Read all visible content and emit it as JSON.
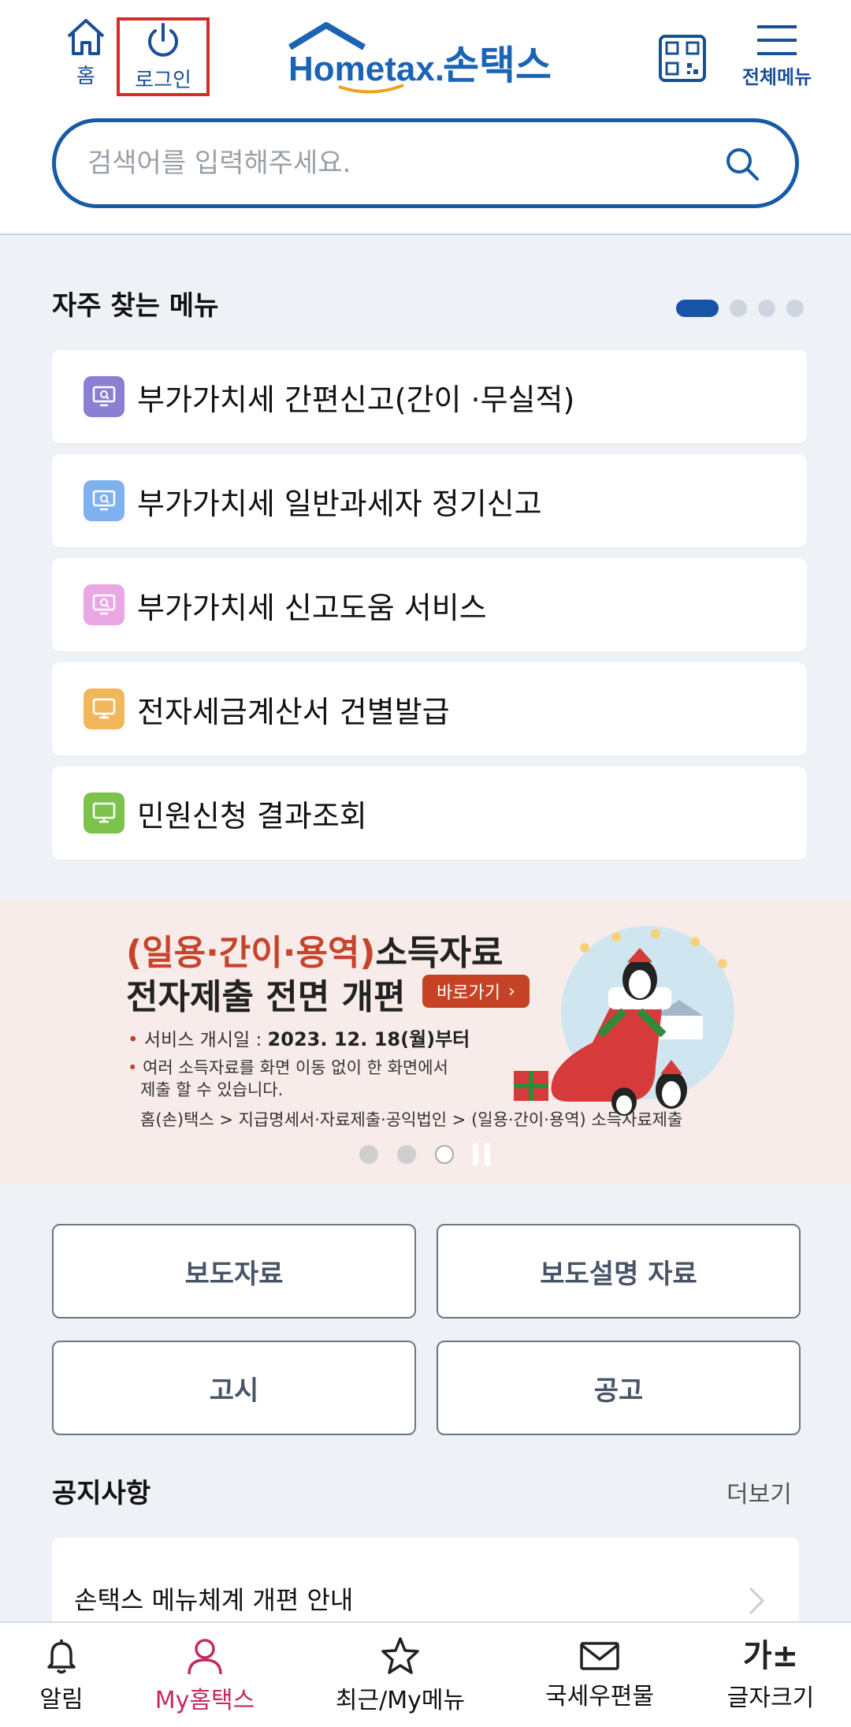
{
  "header": {
    "home_label": "홈",
    "login_label": "로그인",
    "logo_text_en": "Hometax.",
    "logo_text_ko": "손택스",
    "all_menu_label": "전체메뉴"
  },
  "search": {
    "placeholder": "검색어를 입력해주세요."
  },
  "frequent_menu": {
    "title": "자주 찾는 메뉴",
    "pages": 4,
    "active_page": 1,
    "items": [
      {
        "label": "부가가치세 간편신고(간이 ·무실적)",
        "icon_color": "#8b7fd3",
        "icon": "search-monitor-icon"
      },
      {
        "label": "부가가치세 일반과세자 정기신고",
        "icon_color": "#7fb0f0",
        "icon": "search-monitor-icon"
      },
      {
        "label": "부가가치세 신고도움 서비스",
        "icon_color": "#e9a7e3",
        "icon": "search-monitor-icon"
      },
      {
        "label": "전자세금계산서 건별발급",
        "icon_color": "#f2b65c",
        "icon": "monitor-icon"
      },
      {
        "label": "민원신청 결과조회",
        "icon_color": "#7cc24d",
        "icon": "monitor-icon"
      }
    ]
  },
  "banner": {
    "line1_highlight": "(일용·간이·용역)",
    "line1_rest": "소득자료",
    "line2": "전자제출 전면 개편",
    "go_label": "바로가기",
    "bullet1_prefix": "서비스 개시일 : ",
    "bullet1_date": "2023. 12. 18(월)부터",
    "bullet2_line1": "여러 소득자료를 화면 이동 없이 한 화면에서",
    "bullet2_line2": "제출 할 수 있습니다.",
    "path": "홈(손)택스 > 지급명세서·자료제출·공익법인 > (일용·간이·용역) 소득자료제출",
    "slides": 3,
    "current_slide": 3
  },
  "quick_buttons": {
    "press": "보도자료",
    "press_explain": "보도설명 자료",
    "notice_public": "고시",
    "announcement": "공고"
  },
  "notice": {
    "title": "공지사항",
    "more_label": "더보기",
    "items": [
      {
        "text": "손택스 메뉴체계 개편 안내"
      }
    ]
  },
  "bottom_nav": {
    "alarm": "알림",
    "my_hometax": "My홈택스",
    "recent_my_menu": "최근/My메뉴",
    "tax_mail": "국세우편물",
    "font_size": "글자크기",
    "font_size_glyph": "가±",
    "active": "My홈택스",
    "active_color": "#c22a63"
  }
}
